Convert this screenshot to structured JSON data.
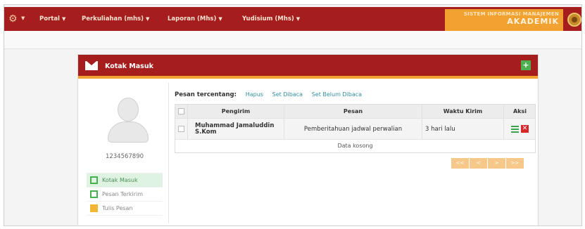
{
  "nav": {
    "menus": [
      {
        "label": "Portal"
      },
      {
        "label": "Perkuliahan (mhs)"
      },
      {
        "label": "Laporan (Mhs)"
      },
      {
        "label": "Yudisium (Mhs)"
      }
    ],
    "brand_line1": "SISTEM INFORMASI MANAJEMEN",
    "brand_line2": "AKADEMIK"
  },
  "panel": {
    "title": "Kotak Masuk",
    "add_label": "+"
  },
  "profile": {
    "nim": "1234567890",
    "menu": [
      {
        "label": "Kotak Masuk",
        "active": true
      },
      {
        "label": "Pesan Terkirim",
        "active": false
      },
      {
        "label": "Tulis Pesan",
        "active": false
      }
    ]
  },
  "bulk": {
    "label": "Pesan tercentang:",
    "actions": [
      "Hapus",
      "Set Dibaca",
      "Set Belum Dibaca"
    ]
  },
  "table": {
    "headers": [
      "Pengirim",
      "Pesan",
      "Waktu Kirim",
      "Aksi"
    ],
    "rows": [
      {
        "sender": "Muhammad Jamaluddin S.Kom",
        "message": "Pemberitahuan jadwal perwalian",
        "time": "3 hari lalu"
      }
    ],
    "empty_text": "Data kosong"
  },
  "pager": [
    "<<",
    "<",
    ">",
    ">>"
  ],
  "colors": {
    "primary": "#a51d1d",
    "accent": "#f2a230",
    "success": "#4caf50",
    "danger": "#d62828"
  }
}
